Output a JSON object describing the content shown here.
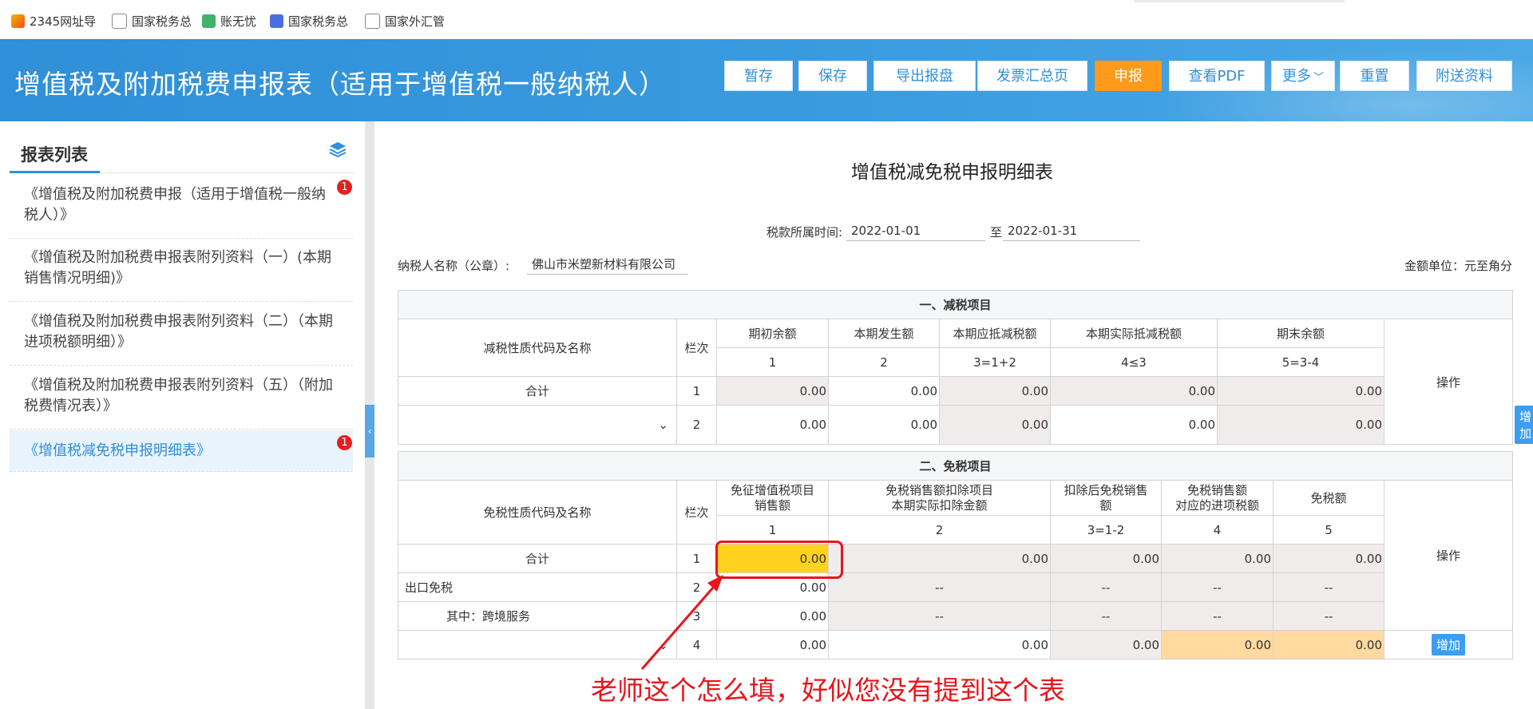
{
  "bookmarks": [
    "2345网址导",
    "国家税务总",
    "账无忧",
    "国家税务总",
    "国家外汇管"
  ],
  "header": {
    "title": "增值税及附加税费申报表（适用于增值税一般纳税人）",
    "buttons": [
      "暂存",
      "保存",
      "导出报盘",
      "发票汇总页",
      "申报",
      "查看PDF",
      "更多",
      "重置",
      "附送资料"
    ]
  },
  "sidebar": {
    "title": "报表列表",
    "items": [
      {
        "label": "《增值税及附加税费申报（适用于增值税一般纳税人）》",
        "badge": "1"
      },
      {
        "label": "《增值税及附加税费申报表附列资料（一）(本期销售情况明细)》"
      },
      {
        "label": "《增值税及附加税费申报表附列资料（二）（本期进项税额明细）》"
      },
      {
        "label": "《增值税及附加税费申报表附列资料（五）（附加税费情况表）》"
      },
      {
        "label": "《增值税减免税申报明细表》",
        "badge": "1"
      }
    ]
  },
  "main": {
    "title": "增值税减免税申报明细表",
    "period_label": "税款所属时间:",
    "period_from": "2022-01-01",
    "period_to_label": "至",
    "period_to": "2022-01-31",
    "taxpayer_label": "纳税人名称（公章）:",
    "taxpayer": "佛山市米塑新材料有限公司",
    "unit": "金额单位：元至角分"
  },
  "reduce": {
    "section": "一、减税项目",
    "name_header": "减税性质代码及名称",
    "col_header": "栏次",
    "op_header": "操作",
    "cols": [
      "期初余额",
      "本期发生额",
      "本期应抵减税额",
      "本期实际抵减税额",
      "期末余额"
    ],
    "col_nums": [
      "1",
      "2",
      "3=1+2",
      "4≤3",
      "5=3-4"
    ],
    "rows": [
      {
        "name": "合计",
        "no": "1",
        "v": [
          "0.00",
          "0.00",
          "0.00",
          "0.00",
          "0.00"
        ]
      },
      {
        "name": "",
        "no": "2",
        "v": [
          "0.00",
          "0.00",
          "0.00",
          "0.00",
          "0.00"
        ],
        "action": "增加"
      }
    ]
  },
  "exempt": {
    "section": "二、免税项目",
    "name_header": "免税性质代码及名称",
    "col_header": "栏次",
    "op_header": "操作",
    "cols": [
      "免征增值税项目\n销售额",
      "免税销售额扣除项目\n本期实际扣除金额",
      "扣除后免税销售\n额",
      "免税销售额\n对应的进项税额",
      "免税额"
    ],
    "col_nums": [
      "1",
      "2",
      "3=1-2",
      "4",
      "5"
    ],
    "rows": [
      {
        "name": "合计",
        "no": "1",
        "v": [
          "0.00",
          "0.00",
          "0.00",
          "0.00",
          "0.00"
        ]
      },
      {
        "name": "出口免税",
        "no": "2",
        "v": [
          "0.00",
          "--",
          "--",
          "--",
          "--"
        ]
      },
      {
        "name": "其中：跨境服务",
        "no": "3",
        "v": [
          "0.00",
          "--",
          "--",
          "--",
          "--"
        ]
      },
      {
        "name": "",
        "no": "4",
        "v": [
          "0.00",
          "0.00",
          "0.00",
          "0.00",
          "0.00"
        ],
        "action": "增加"
      }
    ]
  },
  "annotation": "老师这个怎么填，好似您没有提到这个表",
  "colors": {
    "header_blue": "#2f8fd8",
    "primary_orange": "#ff9a1a",
    "annotation_red": "#e8151b",
    "highlight_yellow": "#ffd21f"
  }
}
